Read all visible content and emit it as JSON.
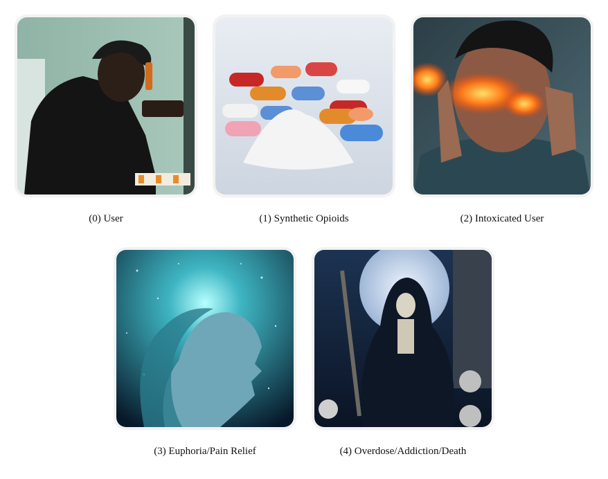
{
  "figure": {
    "panels": [
      {
        "label": "(0) User",
        "image_icon": "person-drinking-icon",
        "accent": "#9cc2b4"
      },
      {
        "label": "(1) Synthetic Opioids",
        "image_icon": "pills-powder-icon",
        "accent": "#dde3ec"
      },
      {
        "label": "(2) Intoxicated User",
        "image_icon": "burning-face-icon",
        "accent": "#ff8a1c"
      },
      {
        "label": "(3) Euphoria/Pain Relief",
        "image_icon": "cosmic-head-icon",
        "accent": "#4fd4d8"
      },
      {
        "label": "(4) Overdose/Addiction/Death",
        "image_icon": "grim-reaper-icon",
        "accent": "#1d2d4a"
      }
    ]
  }
}
